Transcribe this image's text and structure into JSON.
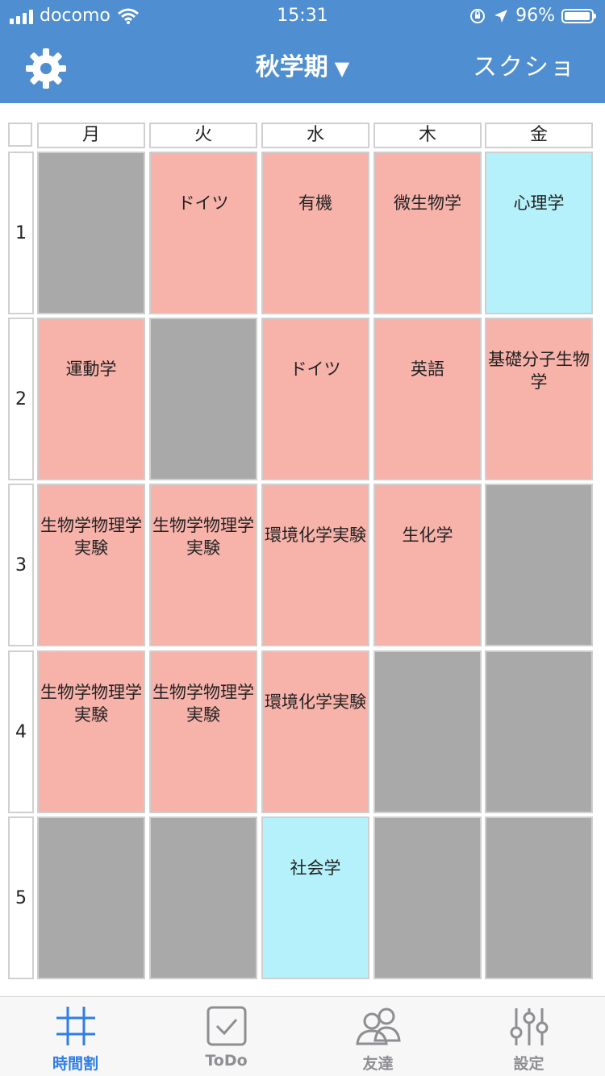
{
  "status_bar": {
    "carrier": "docomo",
    "time": "15:31",
    "battery": "96%"
  },
  "nav": {
    "title": "秋学期",
    "title_arrow": "▼",
    "right_action": "スクショ"
  },
  "days": [
    "月",
    "火",
    "水",
    "木",
    "金"
  ],
  "periods": [
    "1",
    "2",
    "3",
    "4",
    "5"
  ],
  "timetable": [
    [
      {
        "text": "",
        "color": "gray"
      },
      {
        "text": "ドイツ",
        "color": "red"
      },
      {
        "text": "有機",
        "color": "red"
      },
      {
        "text": "微生物学",
        "color": "red"
      },
      {
        "text": "心理学",
        "color": "cyan"
      }
    ],
    [
      {
        "text": "運動学",
        "color": "red"
      },
      {
        "text": "",
        "color": "gray"
      },
      {
        "text": "ドイツ",
        "color": "red"
      },
      {
        "text": "英語",
        "color": "red"
      },
      {
        "text": "基礎分子生物学",
        "color": "red"
      }
    ],
    [
      {
        "text": "生物学物理学実験",
        "color": "red"
      },
      {
        "text": "生物学物理学実験",
        "color": "red"
      },
      {
        "text": "環境化学実験",
        "color": "red"
      },
      {
        "text": "生化学",
        "color": "red"
      },
      {
        "text": "",
        "color": "gray"
      }
    ],
    [
      {
        "text": "生物学物理学実験",
        "color": "red"
      },
      {
        "text": "生物学物理学実験",
        "color": "red"
      },
      {
        "text": "環境化学実験",
        "color": "red"
      },
      {
        "text": "",
        "color": "gray"
      },
      {
        "text": "",
        "color": "gray"
      }
    ],
    [
      {
        "text": "",
        "color": "gray"
      },
      {
        "text": "",
        "color": "gray"
      },
      {
        "text": "社会学",
        "color": "cyan"
      },
      {
        "text": "",
        "color": "gray"
      },
      {
        "text": "",
        "color": "gray"
      }
    ]
  ],
  "tabs": [
    {
      "label": "時間割",
      "icon": "grid-icon",
      "active": true
    },
    {
      "label": "ToDo",
      "icon": "checkbox-icon",
      "active": false
    },
    {
      "label": "友達",
      "icon": "friends-icon",
      "active": false
    },
    {
      "label": "設定",
      "icon": "sliders-icon",
      "active": false
    }
  ],
  "colors": {
    "header_blue": "#4f8ed0",
    "cell_red": "#f7b2aa",
    "cell_gray": "#a9a9a9",
    "cell_cyan": "#b5f1fa",
    "tab_active": "#2f7ee6"
  }
}
